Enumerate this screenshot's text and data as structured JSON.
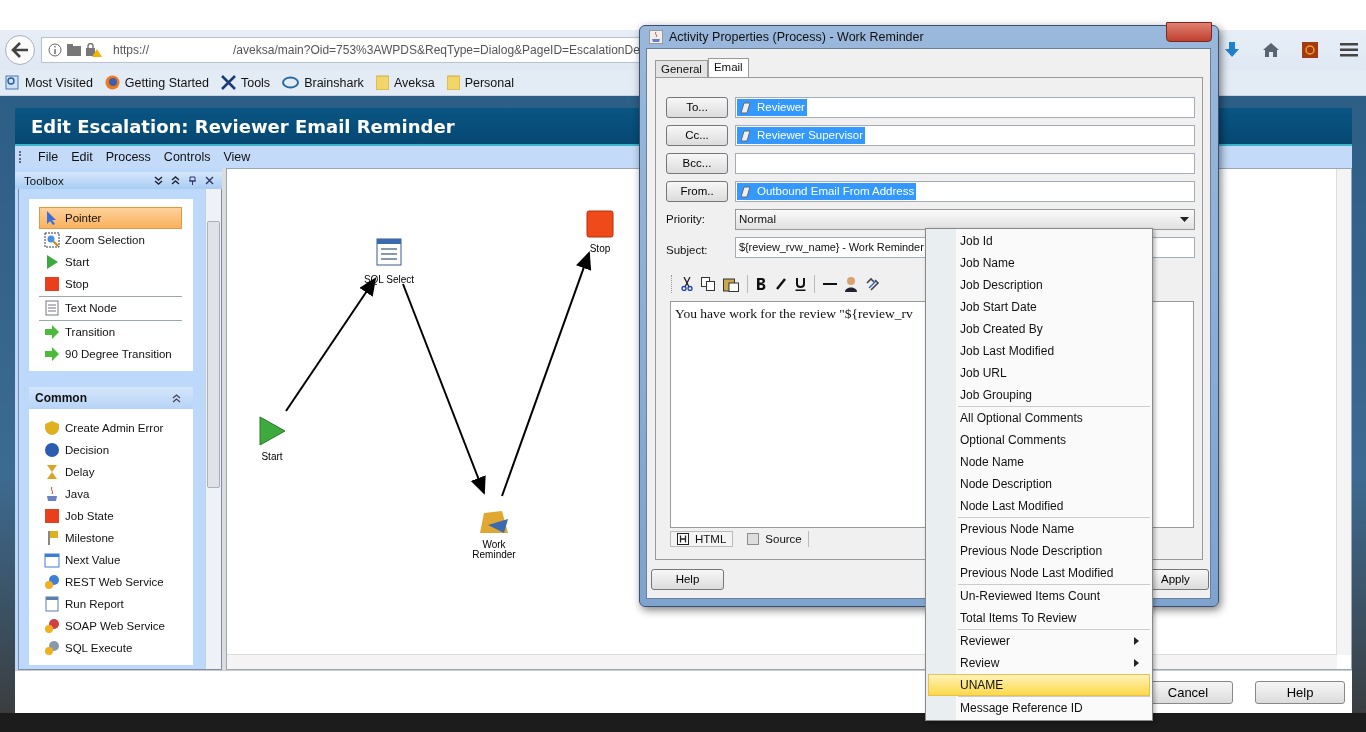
{
  "browser": {
    "url_start": "https://",
    "url_rest": "/aveksa/main?Oid=753%3AWPDS&ReqType=Dialog&PageID=EscalationDe",
    "bookmarks": [
      "Most Visited",
      "Getting Started",
      "Tools",
      "Brainshark",
      "Aveksa",
      "Personal"
    ]
  },
  "app": {
    "title": "Edit Escalation: Reviewer Email Reminder",
    "menu": [
      "File",
      "Edit",
      "Process",
      "Controls",
      "View"
    ],
    "toolbox": {
      "title": "Toolbox",
      "sections": [
        {
          "groups": [
            [
              {
                "label": "Pointer",
                "selected": true
              },
              {
                "label": "Zoom Selection",
                "selected": false
              },
              {
                "label": "Start",
                "selected": false
              },
              {
                "label": "Stop",
                "selected": false
              }
            ],
            [
              {
                "label": "Text Node",
                "selected": false
              }
            ],
            [
              {
                "label": "Transition",
                "selected": false
              },
              {
                "label": "90 Degree Transition",
                "selected": false
              }
            ]
          ]
        },
        {
          "title": "Common",
          "groups": [
            [
              {
                "label": "Create Admin Error",
                "selected": false
              },
              {
                "label": "Decision",
                "selected": false
              },
              {
                "label": "Delay",
                "selected": false
              },
              {
                "label": "Java",
                "selected": false
              },
              {
                "label": "Job State",
                "selected": false
              },
              {
                "label": "Milestone",
                "selected": false
              },
              {
                "label": "Next Value",
                "selected": false
              },
              {
                "label": "REST Web Service",
                "selected": false
              },
              {
                "label": "Run Report",
                "selected": false
              },
              {
                "label": "SOAP Web Service",
                "selected": false
              },
              {
                "label": "SQL Execute",
                "selected": false
              }
            ]
          ]
        }
      ]
    },
    "nodes": [
      {
        "label": "Start",
        "kind": "start"
      },
      {
        "label": "SQL Select",
        "kind": "sql"
      },
      {
        "label": "Stop",
        "kind": "stop"
      },
      {
        "label": "Work\nReminder",
        "kind": "email"
      }
    ],
    "footer_buttons": [
      "Cancel",
      "Help"
    ]
  },
  "dialog": {
    "title": "Activity Properties (Process) - Work Reminder",
    "tabs": [
      {
        "label": "General",
        "selected": false
      },
      {
        "label": "Email",
        "selected": true
      }
    ],
    "address_fields": [
      {
        "button": "To...",
        "value": "Reviewer"
      },
      {
        "button": "Cc...",
        "value": "Reviewer Supervisor"
      },
      {
        "button": "Bcc..."
      },
      {
        "button": "From..",
        "value": "Outbound Email From Address"
      }
    ],
    "priority_label": "Priority:",
    "priority": "Normal",
    "subject_label": "Subject:",
    "subject": "${review_rvw_name} - Work Reminder",
    "body": "You have work for the review \"${review_rv",
    "editor_tabs": [
      {
        "label": "HTML",
        "selected": true
      },
      {
        "label": "Source",
        "selected": false
      }
    ],
    "help_button": "Help",
    "apply_button": "Apply"
  },
  "context_menu": {
    "groups": [
      [
        {
          "label": "Job Id",
          "submenu": false,
          "selected": false
        },
        {
          "label": "Job Name",
          "submenu": false,
          "selected": false
        },
        {
          "label": "Job Description",
          "submenu": false,
          "selected": false
        },
        {
          "label": "Job Start Date",
          "submenu": false,
          "selected": false
        },
        {
          "label": "Job Created By",
          "submenu": false,
          "selected": false
        },
        {
          "label": "Job Last Modified",
          "submenu": false,
          "selected": false
        },
        {
          "label": "Job URL",
          "submenu": false,
          "selected": false
        },
        {
          "label": "Job Grouping",
          "submenu": false,
          "selected": false
        }
      ],
      [
        {
          "label": "All Optional Comments",
          "submenu": false,
          "selected": false
        },
        {
          "label": "Optional Comments",
          "submenu": false,
          "selected": false
        },
        {
          "label": "Node Name",
          "submenu": false,
          "selected": false
        },
        {
          "label": "Node Description",
          "submenu": false,
          "selected": false
        },
        {
          "label": "Node Last Modified",
          "submenu": false,
          "selected": false
        }
      ],
      [
        {
          "label": "Previous Node Name",
          "submenu": false,
          "selected": false
        },
        {
          "label": "Previous Node Description",
          "submenu": false,
          "selected": false
        },
        {
          "label": "Previous Node Last Modified",
          "submenu": false,
          "selected": false
        }
      ],
      [
        {
          "label": "Un-Reviewed Items Count",
          "submenu": false,
          "selected": false
        },
        {
          "label": "Total Items To Review",
          "submenu": false,
          "selected": false
        }
      ],
      [
        {
          "label": "Reviewer",
          "submenu": true,
          "selected": false
        },
        {
          "label": "Review",
          "submenu": true,
          "selected": false
        },
        {
          "label": "UNAME",
          "submenu": false,
          "selected": true
        }
      ],
      [
        {
          "label": "Message Reference ID",
          "submenu": false,
          "selected": false
        }
      ]
    ]
  }
}
